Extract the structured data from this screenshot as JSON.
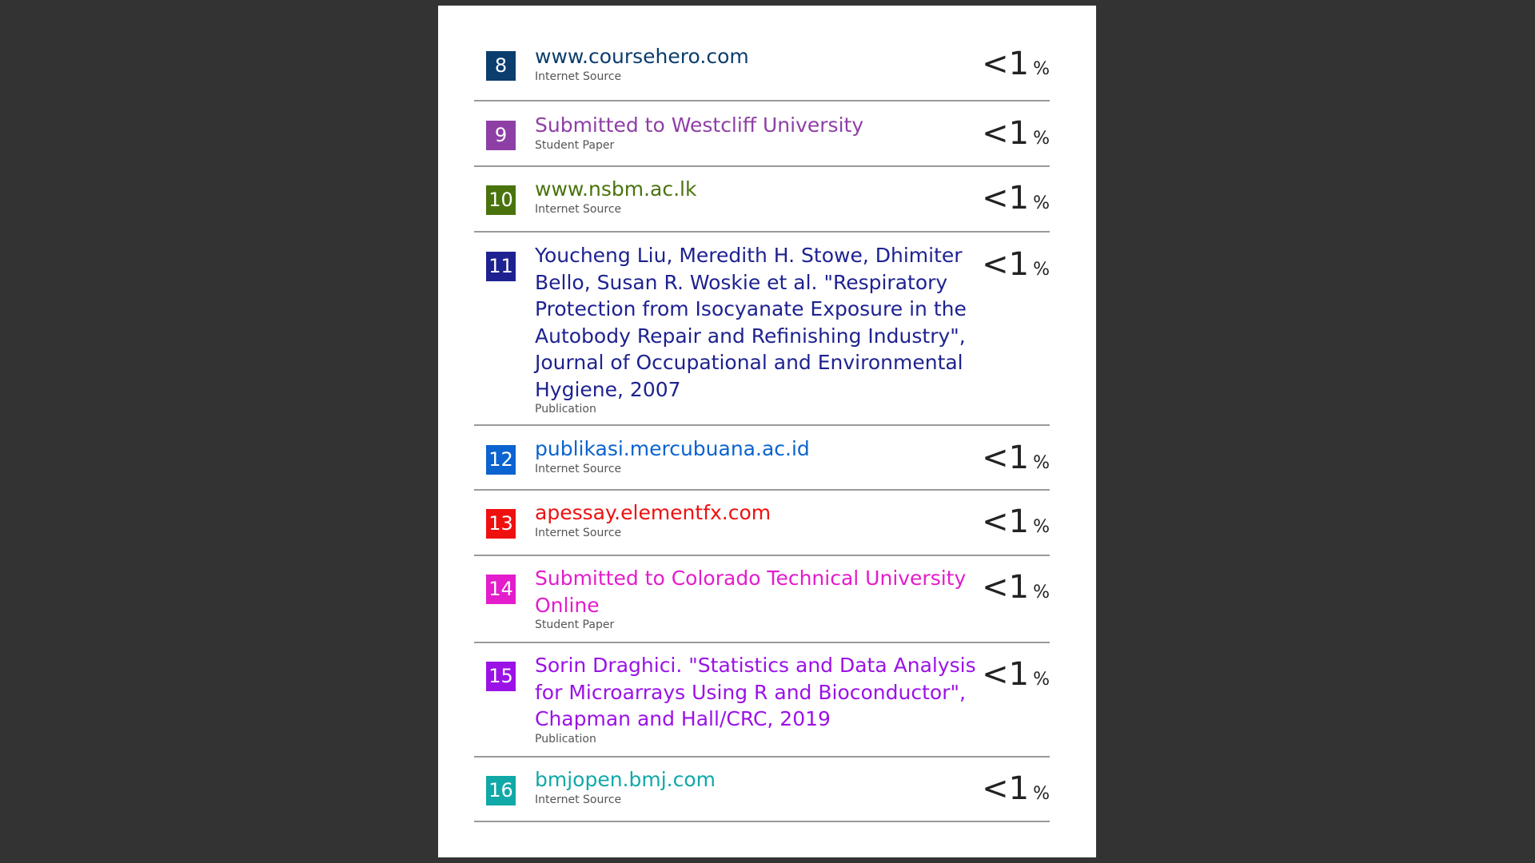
{
  "sources": [
    {
      "number": "8",
      "title_lines": [
        "www.coursehero.com"
      ],
      "type": "Internet Source",
      "percent": "<1",
      "percent_sign": "%",
      "color": "#0b3d6e"
    },
    {
      "number": "9",
      "title_lines": [
        "Submitted to Westcliff University"
      ],
      "type": "Student Paper",
      "percent": "<1",
      "percent_sign": "%",
      "color": "#8e3fa5"
    },
    {
      "number": "10",
      "title_lines": [
        "www.nsbm.ac.lk"
      ],
      "type": "Internet Source",
      "percent": "<1",
      "percent_sign": "%",
      "color": "#4a730e"
    },
    {
      "number": "11",
      "title_lines": [
        "Youcheng Liu, Meredith H. Stowe, Dhimiter",
        "Bello, Susan R. Woskie et al. \"Respiratory",
        "Protection from Isocyanate Exposure in the",
        "Autobody Repair and Refinishing Industry\",",
        "Journal of Occupational and Environmental",
        "Hygiene, 2007"
      ],
      "type": "Publication",
      "percent": "<1",
      "percent_sign": "%",
      "color": "#1e2290"
    },
    {
      "number": "12",
      "title_lines": [
        "publikasi.mercubuana.ac.id"
      ],
      "type": "Internet Source",
      "percent": "<1",
      "percent_sign": "%",
      "color": "#0b63cf"
    },
    {
      "number": "13",
      "title_lines": [
        "apessay.elementfx.com"
      ],
      "type": "Internet Source",
      "percent": "<1",
      "percent_sign": "%",
      "color": "#ef1010"
    },
    {
      "number": "14",
      "title_lines": [
        "Submitted to Colorado Technical University",
        "Online"
      ],
      "type": "Student Paper",
      "percent": "<1",
      "percent_sign": "%",
      "color": "#e31ccc"
    },
    {
      "number": "15",
      "title_lines": [
        "Sorin Draghici. \"Statistics and Data Analysis",
        "for Microarrays Using R and Bioconductor\",",
        "Chapman and Hall/CRC, 2019"
      ],
      "type": "Publication",
      "percent": "<1",
      "percent_sign": "%",
      "color": "#9b12e6"
    },
    {
      "number": "16",
      "title_lines": [
        "bmjopen.bmj.com"
      ],
      "type": "Internet Source",
      "percent": "<1",
      "percent_sign": "%",
      "color": "#11a8a8"
    }
  ]
}
